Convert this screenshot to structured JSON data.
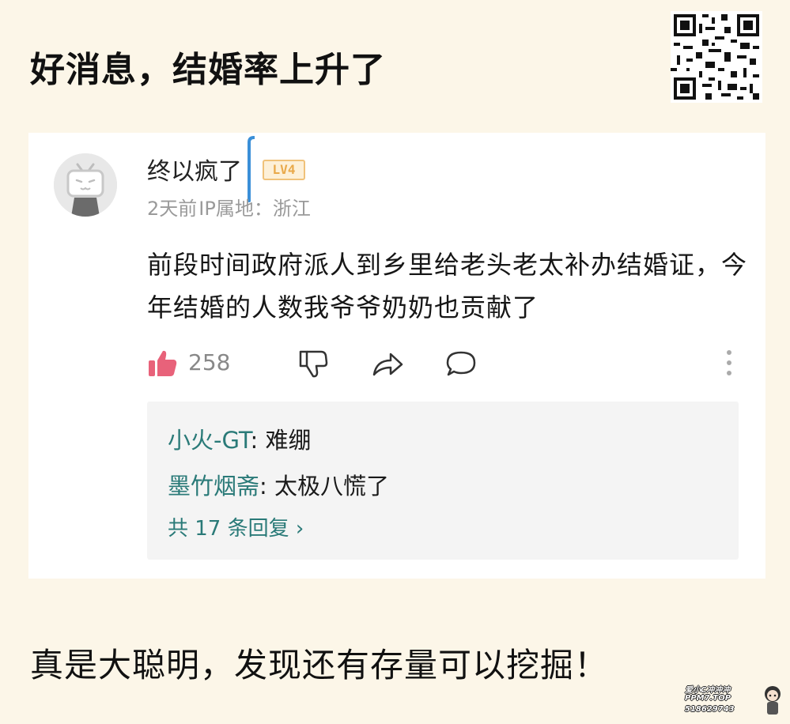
{
  "headline": "好消息，结婚率上升了",
  "comment_card": {
    "username": "终以疯了",
    "level_badge": "LV4",
    "meta": {
      "time": "2天前",
      "ip_label": "IP属地：浙江"
    },
    "comment_text": "前段时间政府派人到乡里给老头老太补办结婚证，今年结婚的人数我爷爷奶奶也贡献了",
    "actions": {
      "like_count": "258",
      "like_color": "#e8627a"
    },
    "replies": [
      {
        "author": "小火-GT",
        "text": "难绷"
      },
      {
        "author": "墨竹烟斋",
        "text": "太极八慌了"
      }
    ],
    "reply_count_label": "共 17 条回复 ›",
    "accent_color": "#2a7a78"
  },
  "footer_text": "真是大聪明，发现还有存量可以挖掘！",
  "watermark": {
    "line1": "爱小C冲冲冲",
    "line2": "PPM7.TOP",
    "line3": "518629743"
  }
}
